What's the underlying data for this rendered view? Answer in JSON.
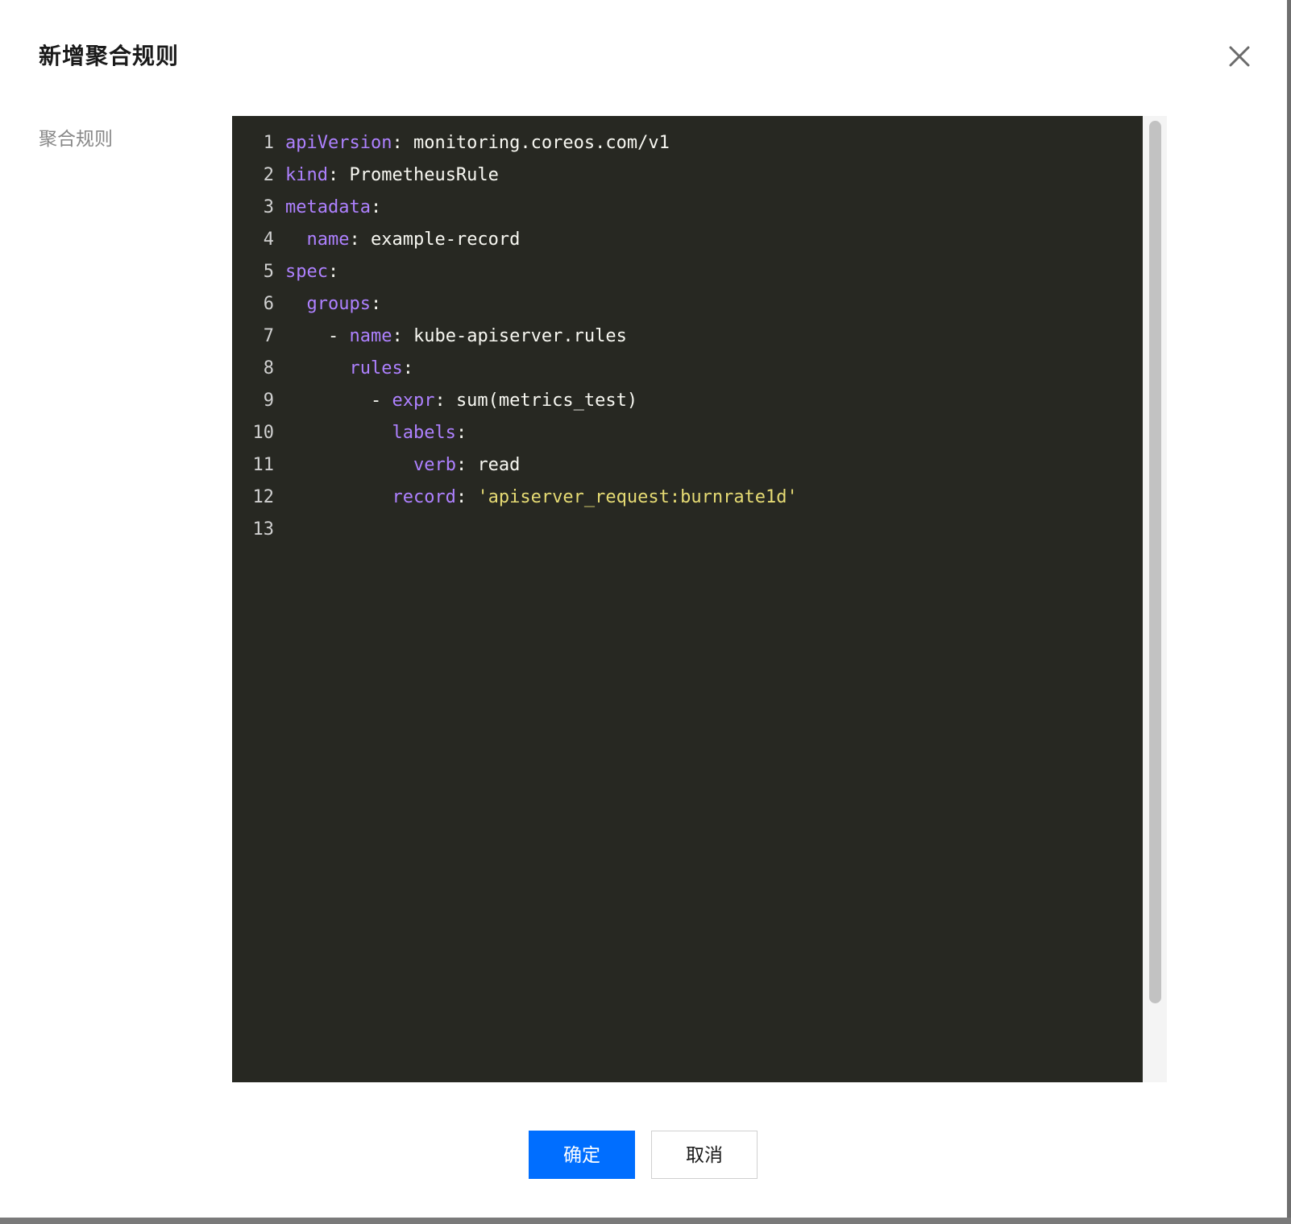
{
  "dialog": {
    "title": "新增聚合规则",
    "close_icon": "close-icon"
  },
  "form": {
    "label": "聚合规则"
  },
  "editor": {
    "theme": {
      "background": "#272822",
      "key": "#ae81ff",
      "text": "#f8f8f2",
      "string": "#e6db74"
    },
    "lines": [
      {
        "num": "1",
        "tokens": [
          {
            "t": "key",
            "v": "apiVersion"
          },
          {
            "t": "punc",
            "v": ": "
          },
          {
            "t": "text",
            "v": "monitoring.coreos.com/v1"
          }
        ]
      },
      {
        "num": "2",
        "tokens": [
          {
            "t": "key",
            "v": "kind"
          },
          {
            "t": "punc",
            "v": ": "
          },
          {
            "t": "text",
            "v": "PrometheusRule"
          }
        ]
      },
      {
        "num": "3",
        "tokens": [
          {
            "t": "key",
            "v": "metadata"
          },
          {
            "t": "punc",
            "v": ":"
          }
        ]
      },
      {
        "num": "4",
        "tokens": [
          {
            "t": "text",
            "v": "  "
          },
          {
            "t": "key",
            "v": "name"
          },
          {
            "t": "punc",
            "v": ": "
          },
          {
            "t": "text",
            "v": "example-record"
          }
        ]
      },
      {
        "num": "5",
        "tokens": [
          {
            "t": "key",
            "v": "spec"
          },
          {
            "t": "punc",
            "v": ":"
          }
        ]
      },
      {
        "num": "6",
        "tokens": [
          {
            "t": "text",
            "v": "  "
          },
          {
            "t": "key",
            "v": "groups"
          },
          {
            "t": "punc",
            "v": ":"
          }
        ]
      },
      {
        "num": "7",
        "tokens": [
          {
            "t": "text",
            "v": "    - "
          },
          {
            "t": "key",
            "v": "name"
          },
          {
            "t": "punc",
            "v": ": "
          },
          {
            "t": "text",
            "v": "kube-apiserver.rules"
          }
        ]
      },
      {
        "num": "8",
        "tokens": [
          {
            "t": "text",
            "v": "      "
          },
          {
            "t": "key",
            "v": "rules"
          },
          {
            "t": "punc",
            "v": ":"
          }
        ]
      },
      {
        "num": "9",
        "tokens": [
          {
            "t": "text",
            "v": "        - "
          },
          {
            "t": "key",
            "v": "expr"
          },
          {
            "t": "punc",
            "v": ": "
          },
          {
            "t": "text",
            "v": "sum(metrics_test)"
          }
        ]
      },
      {
        "num": "10",
        "tokens": [
          {
            "t": "text",
            "v": "          "
          },
          {
            "t": "key",
            "v": "labels"
          },
          {
            "t": "punc",
            "v": ":"
          }
        ]
      },
      {
        "num": "11",
        "tokens": [
          {
            "t": "text",
            "v": "            "
          },
          {
            "t": "key",
            "v": "verb"
          },
          {
            "t": "punc",
            "v": ": "
          },
          {
            "t": "text",
            "v": "read"
          }
        ]
      },
      {
        "num": "12",
        "tokens": [
          {
            "t": "text",
            "v": "          "
          },
          {
            "t": "key",
            "v": "record"
          },
          {
            "t": "punc",
            "v": ": "
          },
          {
            "t": "str",
            "v": "'apiserver_request:burnrate1d'"
          }
        ]
      },
      {
        "num": "13",
        "tokens": []
      }
    ]
  },
  "footer": {
    "confirm_label": "确定",
    "cancel_label": "取消"
  },
  "colors": {
    "primary": "#006eff"
  }
}
